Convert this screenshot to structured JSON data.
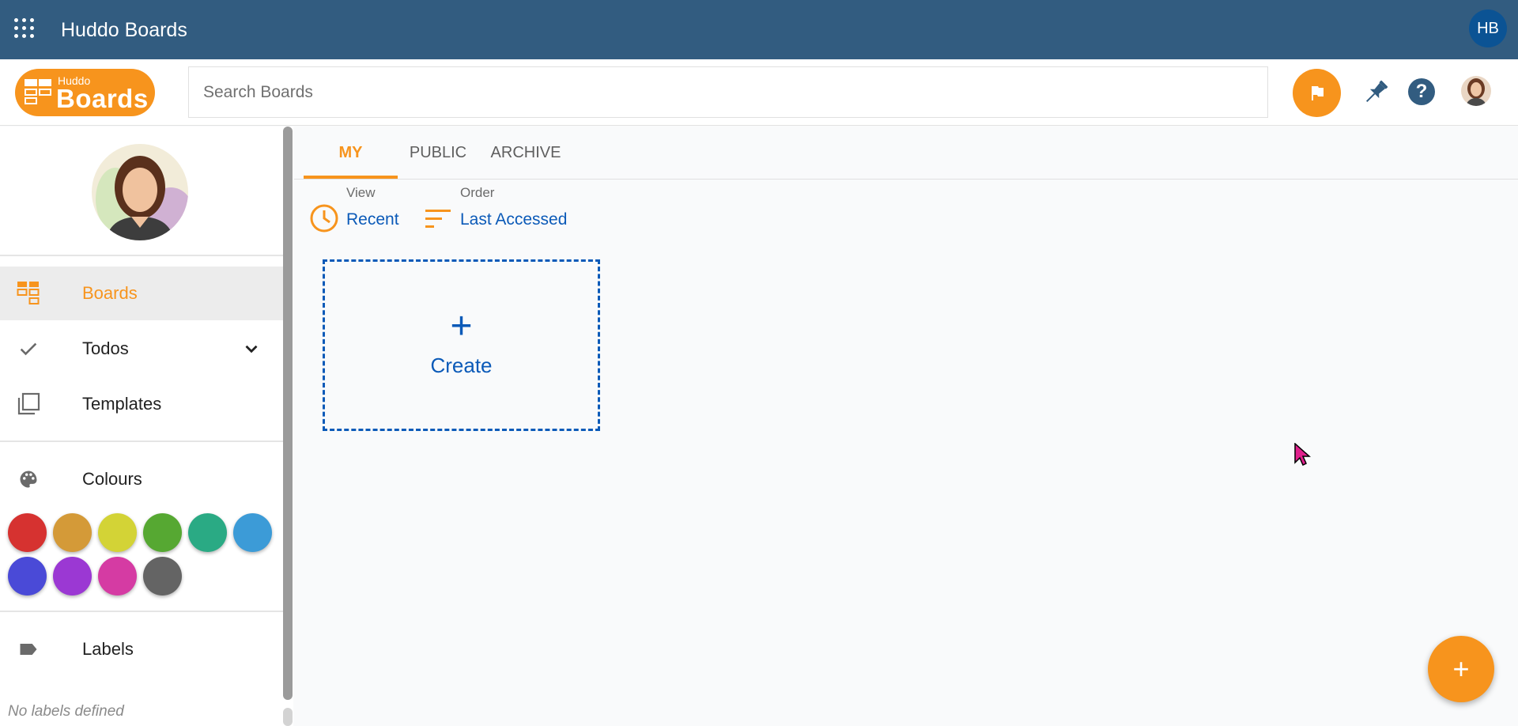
{
  "header": {
    "app_title": "Huddo Boards",
    "user_initials": "HB",
    "apps_icon": "apps-grid-icon",
    "brand_color": "#325c80"
  },
  "toolbar": {
    "logo_small": "Huddo",
    "logo_big": "Boards",
    "search_placeholder": "Search Boards",
    "search_value": "",
    "accent_color": "#f7941d",
    "icons": [
      "flag-icon",
      "pin-icon",
      "help-icon",
      "user-avatar"
    ]
  },
  "sidebar": {
    "nav": [
      {
        "label": "Boards",
        "icon": "boards-icon",
        "active": true
      },
      {
        "label": "Todos",
        "icon": "check-icon",
        "active": false
      },
      {
        "label": "Templates",
        "icon": "templates-icon",
        "active": false
      }
    ],
    "colours_label": "Colours",
    "colours": [
      "#d63230",
      "#d49a38",
      "#d3d336",
      "#56a832",
      "#2aaa84",
      "#3c9bd7",
      "#4a4ad7",
      "#9b38d3",
      "#d53ba3",
      "#646464"
    ],
    "labels_label": "Labels",
    "no_labels_text": "No labels defined"
  },
  "main": {
    "tabs": [
      {
        "label": "MY",
        "active": true
      },
      {
        "label": "PUBLIC",
        "active": false
      },
      {
        "label": "ARCHIVE",
        "active": false
      }
    ],
    "view_label": "View",
    "view_value": "Recent",
    "order_label": "Order",
    "order_value": "Last Accessed",
    "create_plus": "+",
    "create_label": "Create",
    "fab_label": "+"
  }
}
